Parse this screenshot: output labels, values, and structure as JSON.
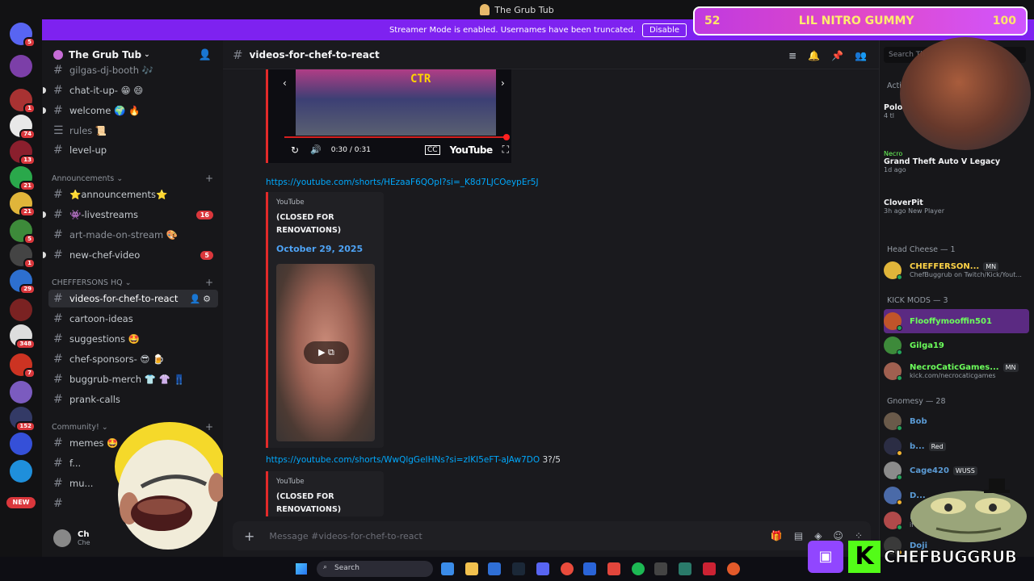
{
  "window": {
    "title": "The Grub Tub"
  },
  "streamer_banner": {
    "text": "Streamer Mode is enabled. Usernames have been truncated.",
    "disable_label": "Disable"
  },
  "overlay": {
    "gummy_left": "52",
    "gummy_title": "LIL NITRO GUMMY",
    "gummy_right": "100"
  },
  "server": {
    "name": "The Grub Tub"
  },
  "servers": [
    {
      "color": "#5865f2",
      "badge": "5"
    },
    {
      "color": "#7c3fa8",
      "badge": ""
    },
    {
      "color": "#a83232",
      "badge": "1"
    },
    {
      "color": "#e8e8e8",
      "badge": "74"
    },
    {
      "color": "#8a1f2d",
      "badge": "13"
    },
    {
      "color": "#2aa84b",
      "badge": "21"
    },
    {
      "color": "#e0b53a",
      "badge": "21"
    },
    {
      "color": "#3d8a3a",
      "badge": "5"
    },
    {
      "color": "#444",
      "badge": "1"
    },
    {
      "color": "#2d6fcf",
      "badge": "29"
    },
    {
      "color": "#7a2222",
      "badge": ""
    },
    {
      "color": "#ddd",
      "badge": "348"
    },
    {
      "color": "#c32",
      "badge": "7"
    },
    {
      "color": "#7b5bbf",
      "badge": ""
    },
    {
      "color": "#333a66",
      "badge": "152"
    },
    {
      "color": "#3550d8",
      "badge": ""
    },
    {
      "color": "#1f8fdb",
      "badge": ""
    }
  ],
  "servers_new_label": "NEW",
  "channels": {
    "top": [
      {
        "name": "gilgas-dj-booth 🎶",
        "dim": true
      },
      {
        "name": "chat-it-up- 😁 😄",
        "dot": true
      },
      {
        "name": "welcome 🌍 🔥",
        "dot": true
      },
      {
        "name": "rules 📜",
        "dim": true,
        "icon": "☰"
      },
      {
        "name": "level-up"
      }
    ],
    "announcements_label": "Announcements",
    "announcements": [
      {
        "name": "⭐announcements⭐",
        "dot": false
      },
      {
        "name": "👾-livestreams",
        "dot": true,
        "count": "16"
      },
      {
        "name": "art-made-on-stream 🎨",
        "dim": true
      },
      {
        "name": "new-chef-video",
        "dot": true,
        "count": "5"
      }
    ],
    "hq_label": "CHEFFERSONS HQ",
    "hq": [
      {
        "name": "videos-for-chef-to-react",
        "active": true
      },
      {
        "name": "cartoon-ideas"
      },
      {
        "name": "suggestions 🤩"
      },
      {
        "name": "chef-sponsors- 😎 🍺"
      },
      {
        "name": "buggrub-merch 👕 👚 👖"
      },
      {
        "name": "prank-calls"
      }
    ],
    "community_label": "Community!",
    "community": [
      {
        "name": "memes 🤩"
      },
      {
        "name": "f..."
      },
      {
        "name": "mu..."
      },
      {
        "name": ""
      }
    ]
  },
  "user": {
    "name": "Ch",
    "status": "Che"
  },
  "main": {
    "channel_name": "videos-for-chef-to-react",
    "video1": {
      "time": "0:30 / 0:31",
      "brand": "YouTube",
      "game_logo": "CTR"
    },
    "messages": [
      {
        "link": "https://youtube.com/shorts/HEzaaF6QOpI?si=_K8d7LJCOeypEr5J",
        "suffix": "",
        "provider": "YouTube",
        "title": "(CLOSED FOR RENOVATIONS)",
        "date": "October 29, 2025"
      },
      {
        "link": "https://youtube.com/shorts/WwQlgGeIHNs?si=zIKI5eFT-aJAw7DO",
        "suffix": " 3?/5",
        "provider": "YouTube",
        "title": "(CLOSED FOR RENOVATIONS)"
      }
    ],
    "composer_placeholder": "Message #videos-for-chef-to-react"
  },
  "members": {
    "search_placeholder": "Search Th",
    "activity_label": "Acti",
    "activities": [
      {
        "name": "Polo",
        "sub": "4 tl"
      },
      {
        "name": "Grand Theft Auto V Legacy",
        "sub": "1d ago",
        "owner": "Necro"
      },
      {
        "name": "CloverPit",
        "sub": "3h ago",
        "badge": "New Player"
      }
    ],
    "head_cheese_label": "Head Cheese — 1",
    "head_cheese": [
      {
        "name": "CHEFFERSON...",
        "tag": "MN",
        "sub": "ChefBuggrub on Twitch/Kick/Yout...",
        "color": "#ffd447"
      }
    ],
    "kick_mods_label": "KICK MODS — 3",
    "kick_mods": [
      {
        "name": "Flooffymooffin501",
        "color": "#6cff5b",
        "highlight": true
      },
      {
        "name": "Gilga19",
        "color": "#6cff5b"
      },
      {
        "name": "NecroCaticGames...",
        "tag": "MN",
        "sub": "kick.com/necrocaticgames",
        "color": "#6cff5b"
      }
    ],
    "gnomesy_label": "Gnomesy — 28",
    "gnomesy": [
      {
        "name": "Bob",
        "color": "#5b9bd5"
      },
      {
        "name": "b...",
        "tag": "Red",
        "color": "#5b9bd5"
      },
      {
        "name": "Cage420",
        "tag": "WUSS",
        "color": "#5b9bd5"
      },
      {
        "name": "D...",
        "color": "#5b9bd5"
      },
      {
        "name": "...",
        "sub": "if u got no...",
        "color": "#5b9bd5"
      },
      {
        "name": "Doji",
        "color": "#5b9bd5"
      }
    ]
  },
  "brand": {
    "name": "CHEFBUGGRUB"
  },
  "taskbar": {
    "search_label": "Search"
  }
}
